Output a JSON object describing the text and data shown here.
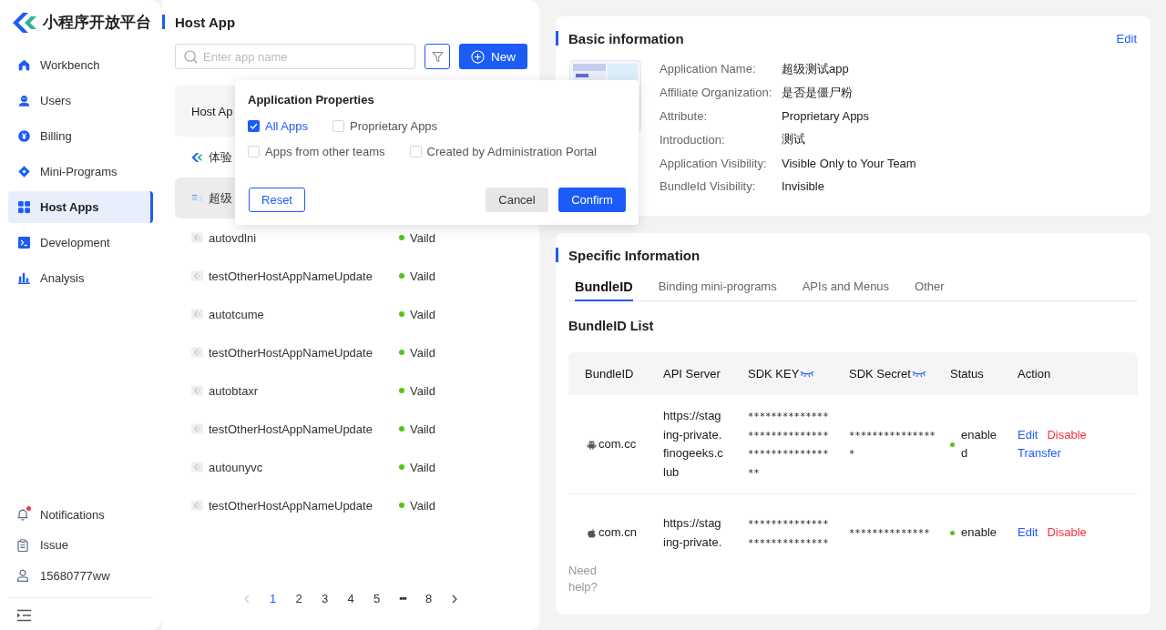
{
  "sidebar": {
    "brand": "小程序开放平台",
    "items": [
      {
        "label": "Workbench",
        "selected": false
      },
      {
        "label": "Users",
        "selected": false
      },
      {
        "label": "Billing",
        "selected": false
      },
      {
        "label": "Mini-Programs",
        "selected": false
      },
      {
        "label": "Host Apps",
        "selected": true
      },
      {
        "label": "Development",
        "selected": false
      },
      {
        "label": "Analysis",
        "selected": false
      }
    ],
    "footer_items": [
      {
        "label": "Notifications",
        "unread": true
      },
      {
        "label": "Issue",
        "unread": false
      },
      {
        "label": "15680777ww",
        "unread": false
      }
    ]
  },
  "host_app_panel": {
    "title": "Host App",
    "search": {
      "placeholder": "Enter app name"
    },
    "filter_button": {
      "active": true
    },
    "new_button": "New",
    "table": {
      "columns": [
        "Host Ap"
      ],
      "rows": [
        {
          "kind": "logo",
          "name": "体验",
          "selected": false
        },
        {
          "kind": "thumbnail",
          "name": "超级",
          "selected": true
        },
        {
          "kind": "default",
          "name": "autovdlni",
          "status": "Vaild",
          "selected": false
        },
        {
          "kind": "default",
          "name": "testOtherHostAppNameUpdate",
          "status": "Vaild",
          "selected": false
        },
        {
          "kind": "default",
          "name": "autotcume",
          "status": "Vaild",
          "selected": false
        },
        {
          "kind": "default",
          "name": "testOtherHostAppNameUpdate",
          "status": "Vaild",
          "selected": false
        },
        {
          "kind": "default",
          "name": "autobtaxr",
          "status": "Vaild",
          "selected": false
        },
        {
          "kind": "default",
          "name": "testOtherHostAppNameUpdate",
          "status": "Vaild",
          "selected": false
        },
        {
          "kind": "default",
          "name": "autounyvc",
          "status": "Vaild",
          "selected": false
        },
        {
          "kind": "default",
          "name": "testOtherHostAppNameUpdate",
          "status": "Vaild",
          "selected": false
        }
      ]
    },
    "pagination": {
      "prev_disabled": true,
      "next_disabled": false,
      "pages": [
        {
          "kind": "page",
          "label": "1",
          "selected": true
        },
        {
          "kind": "page",
          "label": "2",
          "selected": false
        },
        {
          "kind": "page",
          "label": "3",
          "selected": false
        },
        {
          "kind": "page",
          "label": "4",
          "selected": false
        },
        {
          "kind": "page",
          "label": "5",
          "selected": false
        },
        {
          "kind": "ellipsis",
          "label": "•••",
          "selected": false
        },
        {
          "kind": "page",
          "label": "8",
          "selected": false
        }
      ]
    }
  },
  "filter_popover": {
    "title": "Application Properties",
    "options": [
      {
        "label": "All Apps",
        "checked": true
      },
      {
        "label": "Proprietary Apps",
        "checked": false
      },
      {
        "label": "Apps from other teams",
        "checked": false
      },
      {
        "label": "Created by Administration Portal",
        "checked": false
      }
    ],
    "reset_button": "Reset",
    "cancel_button": "Cancel",
    "confirm_button": "Confirm"
  },
  "basic_information": {
    "title": "Basic information",
    "edit_link": "Edit",
    "fields": [
      {
        "label": "Application Name:",
        "value": "超级测试app"
      },
      {
        "label": "Affiliate Organization:",
        "value": "是否是僵尸粉"
      },
      {
        "label": "Attribute:",
        "value": "Proprietary Apps"
      },
      {
        "label": "Introduction:",
        "value": "测试"
      },
      {
        "label": "Application Visibility:",
        "value": "Visible Only to Your Team"
      },
      {
        "label": "BundleId Visibility:",
        "value": "Invisible"
      }
    ]
  },
  "specific_information": {
    "title": "Specific Information",
    "tabs": [
      {
        "label": "BundleID",
        "selected": true
      },
      {
        "label": "Binding mini-programs",
        "selected": false
      },
      {
        "label": "APIs and Menus",
        "selected": false
      },
      {
        "label": "Other",
        "selected": false
      }
    ],
    "list_title": "BundleID List",
    "table": {
      "columns": [
        {
          "label": "BundleID",
          "masked": false
        },
        {
          "label": "API Server",
          "masked": false
        },
        {
          "label": "SDK KEY",
          "masked": true
        },
        {
          "label": "SDK Secret",
          "masked": true
        },
        {
          "label": "Status",
          "masked": false
        },
        {
          "label": "Action",
          "masked": false
        }
      ],
      "rows": [
        {
          "kind": "android",
          "bundle_id": "com.cc",
          "api_server": "https://staging-private.finogeeks.club",
          "sdk_key": "********************************************",
          "sdk_secret": "****************",
          "status": "enabled",
          "actions": [
            {
              "label": "Edit",
              "kind": "primary"
            },
            {
              "label": "Disable",
              "kind": "danger"
            },
            {
              "label": "Transfer",
              "kind": "primary"
            }
          ]
        },
        {
          "kind": "ios",
          "bundle_id": "com.cn",
          "api_server": "https://staging-private.",
          "sdk_key": "****************************",
          "sdk_secret": "**************",
          "status": "enable",
          "actions": [
            {
              "label": "Edit",
              "kind": "primary"
            },
            {
              "label": "Disable",
              "kind": "danger"
            }
          ]
        }
      ]
    },
    "help_link": "Need help?"
  }
}
